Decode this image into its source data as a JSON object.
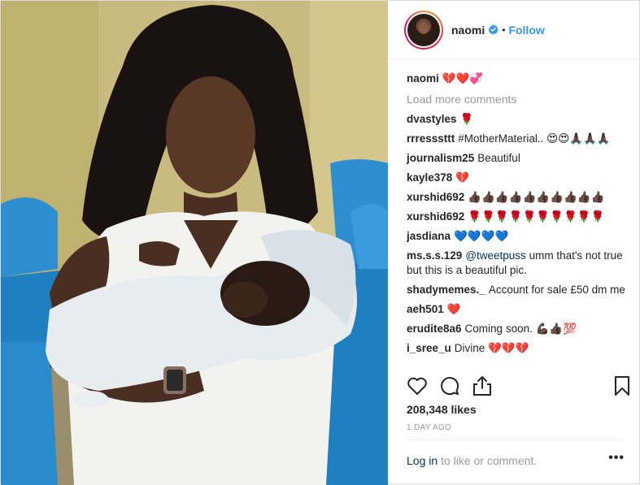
{
  "header": {
    "username": "naomi",
    "separator": "•",
    "follow_label": "Follow"
  },
  "caption": {
    "username": "naomi",
    "text": "💔❤️💞"
  },
  "load_more_label": "Load more comments",
  "comments": [
    {
      "user": "dvastyles",
      "text": "🌹"
    },
    {
      "user": "rrresssttt",
      "text": "#MotherMaterial.. 😍😍🙏🏿🙏🏿🙏🏿"
    },
    {
      "user": "journalism25",
      "text": "Beautiful"
    },
    {
      "user": "kayle378",
      "text": "💔"
    },
    {
      "user": "xurshid692",
      "text": "👍🏿👍🏿👍🏿👍🏿👍🏿👍🏿👍🏿👍🏿👍🏿👍🏿"
    },
    {
      "user": "xurshid692",
      "text": "🌹🌹🌹🌹🌹🌹🌹🌹🌹🌹"
    },
    {
      "user": "jasdiana",
      "text": "💙💙💙💙"
    },
    {
      "user": "ms.s.s.129",
      "mention": "@tweetpuss",
      "text": " umm that's not true but this is a beautiful pic."
    },
    {
      "user": "shadymemes._",
      "text": "Account for sale £50 dm me"
    },
    {
      "user": "aeh501",
      "text": "❤️"
    },
    {
      "user": "erudite8a6",
      "text": "Coming soon. 💪🏿👍🏿💯"
    },
    {
      "user": "i_sree_u",
      "text": "Divine 💔💔💔"
    }
  ],
  "actions": {
    "like_icon": "heart-icon",
    "comment_icon": "comment-icon",
    "share_icon": "share-icon",
    "save_icon": "bookmark-icon"
  },
  "likes": "208,348 likes",
  "timestamp": "1 DAY AGO",
  "login": {
    "link": "Log in",
    "rest": " to like or comment.",
    "more": "•••"
  },
  "colors": {
    "link_blue": "#3897f0",
    "mention_blue": "#003569",
    "muted": "#999999",
    "text": "#262626"
  }
}
